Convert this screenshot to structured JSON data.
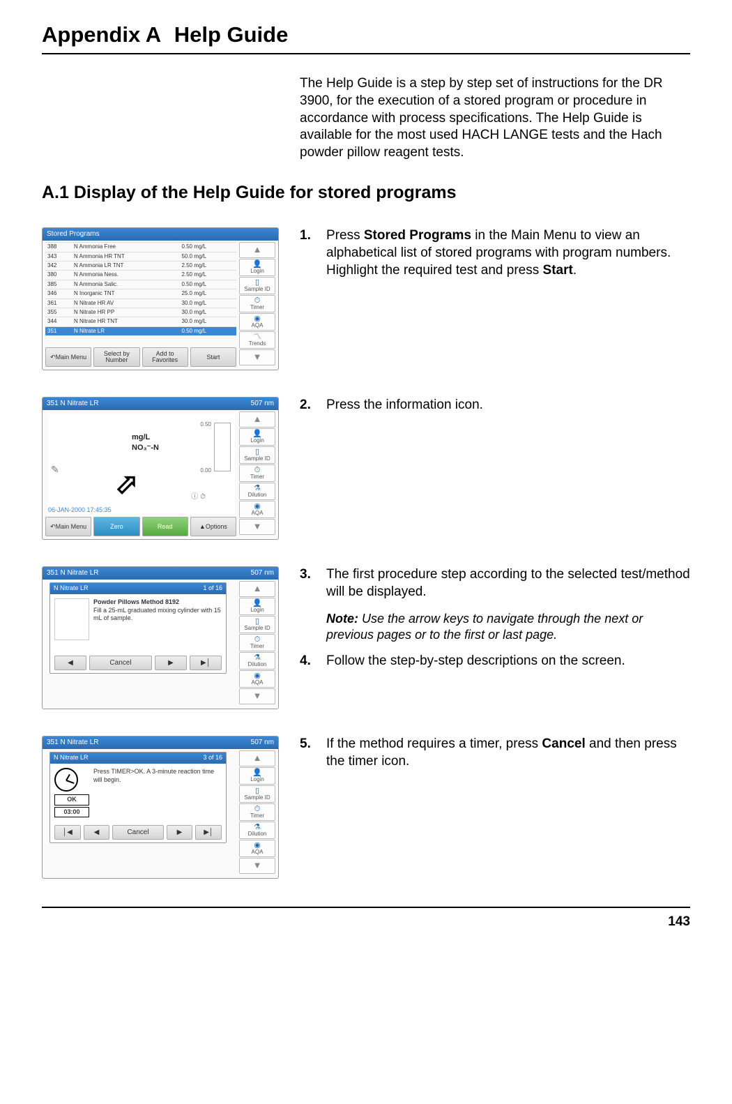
{
  "title_prefix": "Appendix A",
  "title_suffix": "Help Guide",
  "intro": "The Help Guide is a step by step set of instructions for the DR 3900, for the execution of a stored program or procedure in accordance with process specifications. The Help Guide is available for the most used HACH LANGE tests and the Hach powder pillow reagent tests.",
  "section_heading": "A.1 Display of the Help Guide for stored programs",
  "steps": {
    "s1_num": "1.",
    "s1_a": "Press ",
    "s1_b1": "Stored Programs",
    "s1_c": " in the Main Menu to view an alphabetical list of stored programs with program numbers. Highlight the required test and press ",
    "s1_b2": "Start",
    "s1_d": ".",
    "s2_num": "2.",
    "s2_text": "Press the information icon.",
    "s3_num": "3.",
    "s3_text": "The first procedure step according to the selected test/method will be displayed.",
    "s3_note_label": "Note:",
    "s3_note": " Use the arrow keys to navigate through the next or previous pages or to the first or last page.",
    "s4_num": "4.",
    "s4_text": "Follow the step-by-step descriptions on the screen.",
    "s5_num": "5.",
    "s5_a": "If the method requires a timer, press ",
    "s5_b": "Cancel",
    "s5_c": " and then press the timer icon."
  },
  "page_number": "143",
  "shots": {
    "side": {
      "login": "Login",
      "sample": "Sample ID",
      "timer": "Timer",
      "aqa": "AQA",
      "dilution": "Dilution",
      "trends": "Trends"
    },
    "s1": {
      "title": "Stored Programs",
      "btn1": "Main Menu",
      "btn2": "Select by Number",
      "btn3": "Add to Favorites",
      "btn4": "Start",
      "rows": [
        [
          "388",
          "N Ammonia Free",
          "0.50 mg/L"
        ],
        [
          "343",
          "N Ammonia HR TNT",
          "50.0 mg/L"
        ],
        [
          "342",
          "N Ammonia LR TNT",
          "2.50 mg/L"
        ],
        [
          "380",
          "N Ammonia Ness.",
          "2.50 mg/L"
        ],
        [
          "385",
          "N Ammonia Salic.",
          "0.50 mg/L"
        ],
        [
          "346",
          "N Inorganic TNT",
          "25.0 mg/L"
        ],
        [
          "361",
          "N Nitrate HR AV",
          "30.0 mg/L"
        ],
        [
          "355",
          "N Nitrate HR PP",
          "30.0 mg/L"
        ],
        [
          "344",
          "N Nitrate HR TNT",
          "30.0 mg/L"
        ],
        [
          "351",
          "N Nitrate LR",
          "0.50 mg/L"
        ]
      ]
    },
    "s2": {
      "title": "351 N Nitrate LR",
      "wavelength": "507 nm",
      "unit1": "mg/L",
      "unit2": "NO₃⁻-N",
      "t_top": "0.50",
      "t_bot": "0.00",
      "date": "06-JAN-2000  17:45:35",
      "btn1": "Main Menu",
      "btn2": "Zero",
      "btn3": "Read",
      "btn4": "Options"
    },
    "s3": {
      "pop_title": "N Nitrate LR",
      "pop_page": "1 of 16",
      "pop_h": "Powder Pillows Method 8192",
      "pop_body": "Fill a 25-mL graduated mixing cylinder with 15 mL of sample.",
      "pb_prev": "◀",
      "pb_cancel": "Cancel",
      "pb_next": "▶",
      "pb_last": "▶│"
    },
    "s4": {
      "pop_title": "N Nitrate LR",
      "pop_page": "3 of 16",
      "pop_body": "Press TIMER>OK. A 3-minute reaction time will begin.",
      "ok": "OK",
      "timeval": "03:00",
      "pb_first": "│◀",
      "pb_prev": "◀",
      "pb_cancel": "Cancel",
      "pb_next": "▶",
      "pb_last": "▶│"
    }
  }
}
